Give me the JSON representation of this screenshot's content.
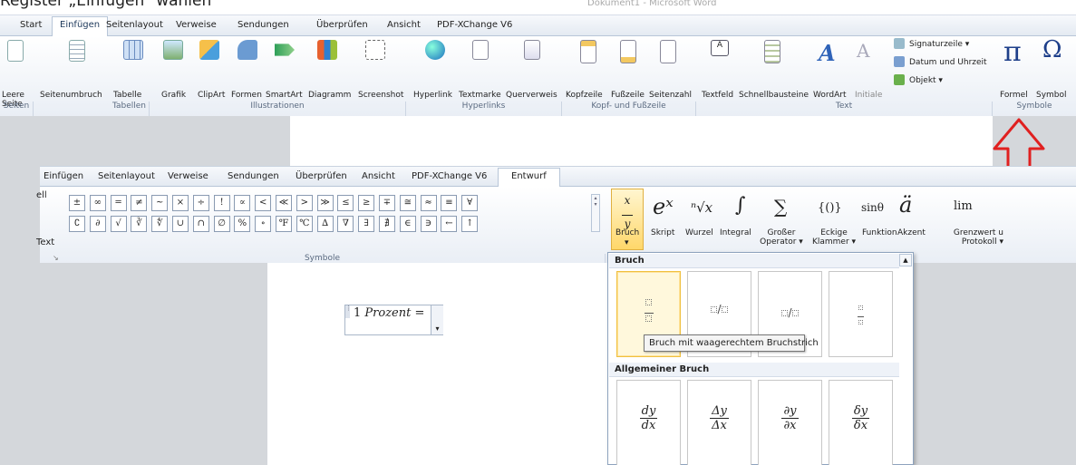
{
  "heading": "Register „Einfügen“ wählen",
  "bg_window_title": "Dokument1 - Microsoft Word",
  "ribbon1": {
    "tabs": [
      "Start",
      "Einfügen",
      "Seitenlayout",
      "Verweise",
      "Sendungen",
      "Überprüfen",
      "Ansicht",
      "PDF-XChange V6"
    ],
    "buttons": {
      "leere_seite": "Leere Seite",
      "seitenumbruch": "Seitenumbruch",
      "tabelle": "Tabelle",
      "grafik": "Grafik",
      "clipart": "ClipArt",
      "formen": "Formen",
      "smartart": "SmartArt",
      "diagramm": "Diagramm",
      "screenshot": "Screenshot",
      "hyperlink": "Hyperlink",
      "textmarke": "Textmarke",
      "querverweis": "Querverweis",
      "kopfzeile": "Kopfzeile",
      "fusszeile": "Fußzeile",
      "seitenzahl": "Seitenzahl",
      "textfeld": "Textfeld",
      "schnellbausteine": "Schnellbausteine",
      "wordart": "WordArt",
      "initiale": "Initiale",
      "signaturzeile": "Signaturzeile ▾",
      "datum": "Datum und Uhrzeit",
      "objekt": "Objekt ▾",
      "formel": "Formel",
      "symbol": "Symbol"
    },
    "groups": {
      "seiten": "Seiten",
      "tabellen": "Tabellen",
      "illustrationen": "Illustrationen",
      "hyperlinks": "Hyperlinks",
      "kopf": "Kopf- und Fußzeile",
      "text": "Text",
      "symbole": "Symbole"
    }
  },
  "ribbon2": {
    "tabs": [
      "Einfügen",
      "Seitenlayout",
      "Verweise",
      "Sendungen",
      "Überprüfen",
      "Ansicht",
      "PDF-XChange V6",
      "Entwurf"
    ],
    "left_cut": [
      "ell",
      "Text"
    ],
    "symbols_row1": [
      "±",
      "∞",
      "=",
      "≠",
      "~",
      "×",
      "÷",
      "!",
      "∝",
      "<",
      "≪",
      ">",
      "≫",
      "≤",
      "≥",
      "∓",
      "≅",
      "≈",
      "≡",
      "∀"
    ],
    "symbols_row2": [
      "∁",
      "∂",
      "√",
      "∛",
      "∜",
      "∪",
      "∩",
      "∅",
      "%",
      "∘",
      "℉",
      "℃",
      "∆",
      "∇",
      "∃",
      "∄",
      "∈",
      "∋",
      "←",
      "↑"
    ],
    "group_symbole": "Symbole",
    "struct_big": [
      "eˣ",
      "ⁿ√x",
      "∫",
      "∑",
      "{()}",
      "sinθ",
      "ä",
      "lim"
    ],
    "struct_labels": {
      "bruch": "Bruch",
      "skript": "Skript",
      "wurzel": "Wurzel",
      "integral": "Integral",
      "grosser": "Großer Operator ▾",
      "eckige": "Eckige Klammer ▾",
      "funktion": "Funktion",
      "akzent": "Akzent",
      "grenzwert": "Grenzwert u Protokoll ▾"
    }
  },
  "equation": {
    "number": "1",
    "text": "Prozent",
    "op": "="
  },
  "gallery": {
    "section1": "Bruch",
    "section2": "Allgemeiner Bruch",
    "tooltip": "Bruch mit waagerechtem Bruchstrich",
    "fractions": [
      {
        "n": "dy",
        "d": "dx"
      },
      {
        "n": "Δy",
        "d": "Δx"
      },
      {
        "n": "∂y",
        "d": "∂x"
      },
      {
        "n": "δy",
        "d": "δx"
      }
    ]
  },
  "colors": {
    "arrow": "#e02020",
    "accent": "#1e395b"
  }
}
